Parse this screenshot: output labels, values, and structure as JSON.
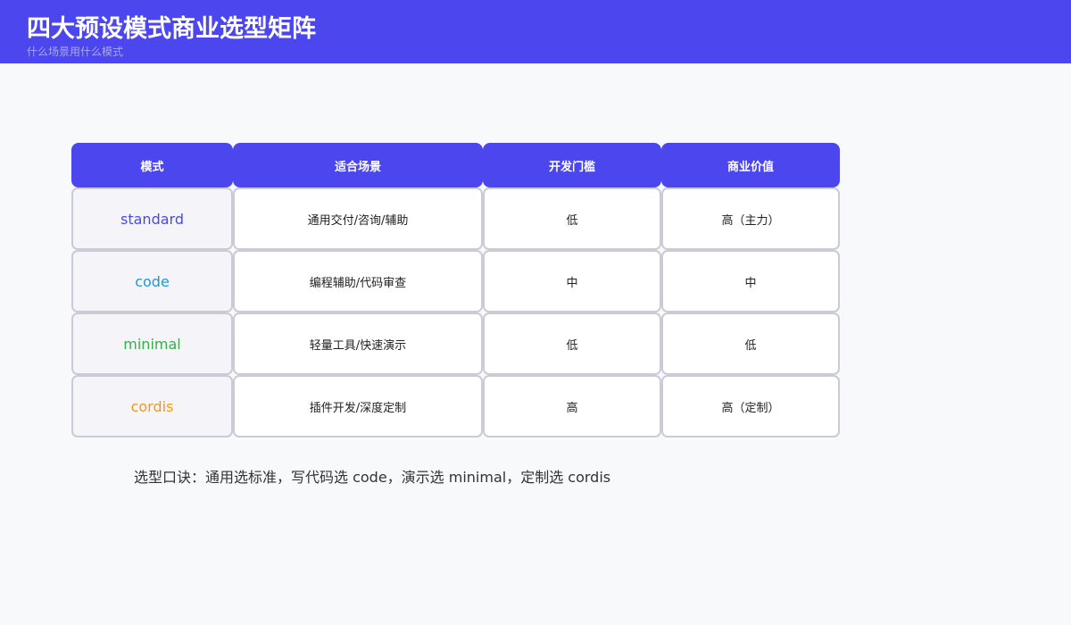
{
  "header": {
    "title": "四大预设模式商业选型矩阵",
    "subtitle": "什么场景用什么模式"
  },
  "table": {
    "headers": [
      "模式",
      "适合场景",
      "开发门槛",
      "商业价值"
    ],
    "rows": [
      {
        "mode": "standard",
        "mode_color": "#4b46ee",
        "scenario": "通用交付/咨询/辅助",
        "threshold": "低",
        "value": "高（主力）"
      },
      {
        "mode": "code",
        "mode_color": "#1a9ad6",
        "scenario": "编程辅助/代码审查",
        "threshold": "中",
        "value": "中"
      },
      {
        "mode": "minimal",
        "mode_color": "#3aae49",
        "scenario": "轻量工具/快速演示",
        "threshold": "低",
        "value": "低"
      },
      {
        "mode": "cordis",
        "mode_color": "#f29a12",
        "scenario": "插件开发/深度定制",
        "threshold": "高",
        "value": "高（定制）"
      }
    ]
  },
  "footnote": "选型口诀：通用选标准，写代码选 code，演示选 minimal，定制选 cordis",
  "colors": {
    "header_bg": "#4b46ee",
    "page_bg": "#f8f9fb",
    "cell_border": "#cbcbd6"
  }
}
